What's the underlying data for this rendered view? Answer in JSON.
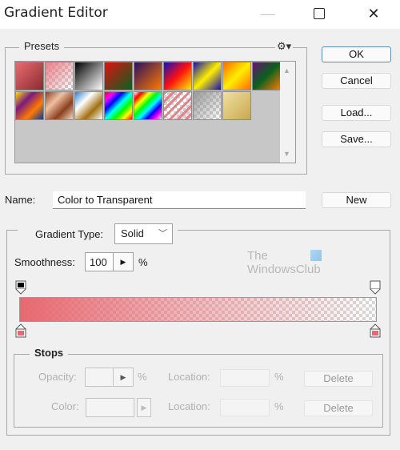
{
  "window": {
    "title": "Gradient Editor",
    "minimize_icon": "minimize-icon",
    "maximize_icon": "maximize-icon",
    "close_icon": "close-icon"
  },
  "presets": {
    "label": "Presets",
    "settings_icon": "gear-icon",
    "scroll_up_icon": "triangle-up-icon",
    "scroll_down_icon": "triangle-down-icon",
    "swatches": [
      {
        "name": "foreground-to-background",
        "colors": [
          "#e86c70",
          "#8a2a30"
        ]
      },
      {
        "name": "foreground-to-transparent",
        "colors": [
          "#e88088",
          "transparent"
        ]
      },
      {
        "name": "black-white",
        "colors": [
          "#000000",
          "#ffffff"
        ]
      },
      {
        "name": "red-green",
        "colors": [
          "#e01010",
          "#0a6020"
        ]
      },
      {
        "name": "violet-orange",
        "colors": [
          "#2a1060",
          "#ff7a00"
        ]
      },
      {
        "name": "blue-red-yellow",
        "colors": [
          "#1010c0",
          "#ff1010",
          "#ffee00"
        ]
      },
      {
        "name": "blue-yellow-blue",
        "colors": [
          "#1010b0",
          "#ffee00",
          "#1010b0"
        ]
      },
      {
        "name": "orange-yellow-orange",
        "colors": [
          "#ff6a00",
          "#ffee00",
          "#ff6a00"
        ]
      },
      {
        "name": "violet-green-orange",
        "colors": [
          "#6a1070",
          "#0a6020",
          "#ff7a00"
        ]
      },
      {
        "name": "yellow-violet-orange-blue",
        "colors": [
          "#ffdd00",
          "#7a1a80",
          "#ff7a00",
          "#0a3a90"
        ]
      },
      {
        "name": "copper",
        "colors": [
          "#8a4020",
          "#f0c0a0",
          "#8a4020",
          "#f0d8c0"
        ]
      },
      {
        "name": "chrome",
        "colors": [
          "#3080d0",
          "#ffffff",
          "#a07010",
          "#ffffff"
        ]
      },
      {
        "name": "spectrum",
        "colors": [
          "#ff0000",
          "#ff00ff",
          "#0000ff",
          "#00ffff",
          "#00ff00",
          "#ffff00",
          "#ff0000"
        ]
      },
      {
        "name": "transparent-rainbow",
        "colors": [
          "transparent",
          "#ff0000",
          "#ffff00",
          "#00ff00",
          "#00ffff",
          "#0000ff",
          "#ff00ff",
          "transparent"
        ]
      },
      {
        "name": "transparent-stripes",
        "colors": [
          "#e88088",
          "transparent"
        ]
      },
      {
        "name": "neutral-density",
        "colors": [
          "#999999",
          "transparent"
        ]
      },
      {
        "name": "gold",
        "colors": [
          "#f0e0a0",
          "#c8a850"
        ]
      }
    ]
  },
  "buttons": {
    "ok": "OK",
    "cancel": "Cancel",
    "load": "Load...",
    "save": "Save...",
    "new": "New"
  },
  "name": {
    "label": "Name:",
    "value": "Color to Transparent"
  },
  "gradient": {
    "type_label": "Gradient Type:",
    "type_value": "Solid",
    "smoothness_label": "Smoothness:",
    "smoothness_value": "100",
    "smoothness_unit": "%",
    "color": "#e86870",
    "opacity_stops": [
      {
        "location_pct": 0,
        "opacity_pct": 100
      },
      {
        "location_pct": 100,
        "opacity_pct": 0
      }
    ],
    "color_stops": [
      {
        "location_pct": 0,
        "color": "#e86870"
      },
      {
        "location_pct": 100,
        "color": "#e86870"
      }
    ]
  },
  "watermark": {
    "line1": "The",
    "line2": "WindowsClub"
  },
  "stops": {
    "label": "Stops",
    "opacity_label": "Opacity:",
    "opacity_value": "",
    "opacity_unit": "%",
    "color_label": "Color:",
    "location_label": "Location:",
    "location_unit": "%",
    "delete_label": "Delete"
  }
}
